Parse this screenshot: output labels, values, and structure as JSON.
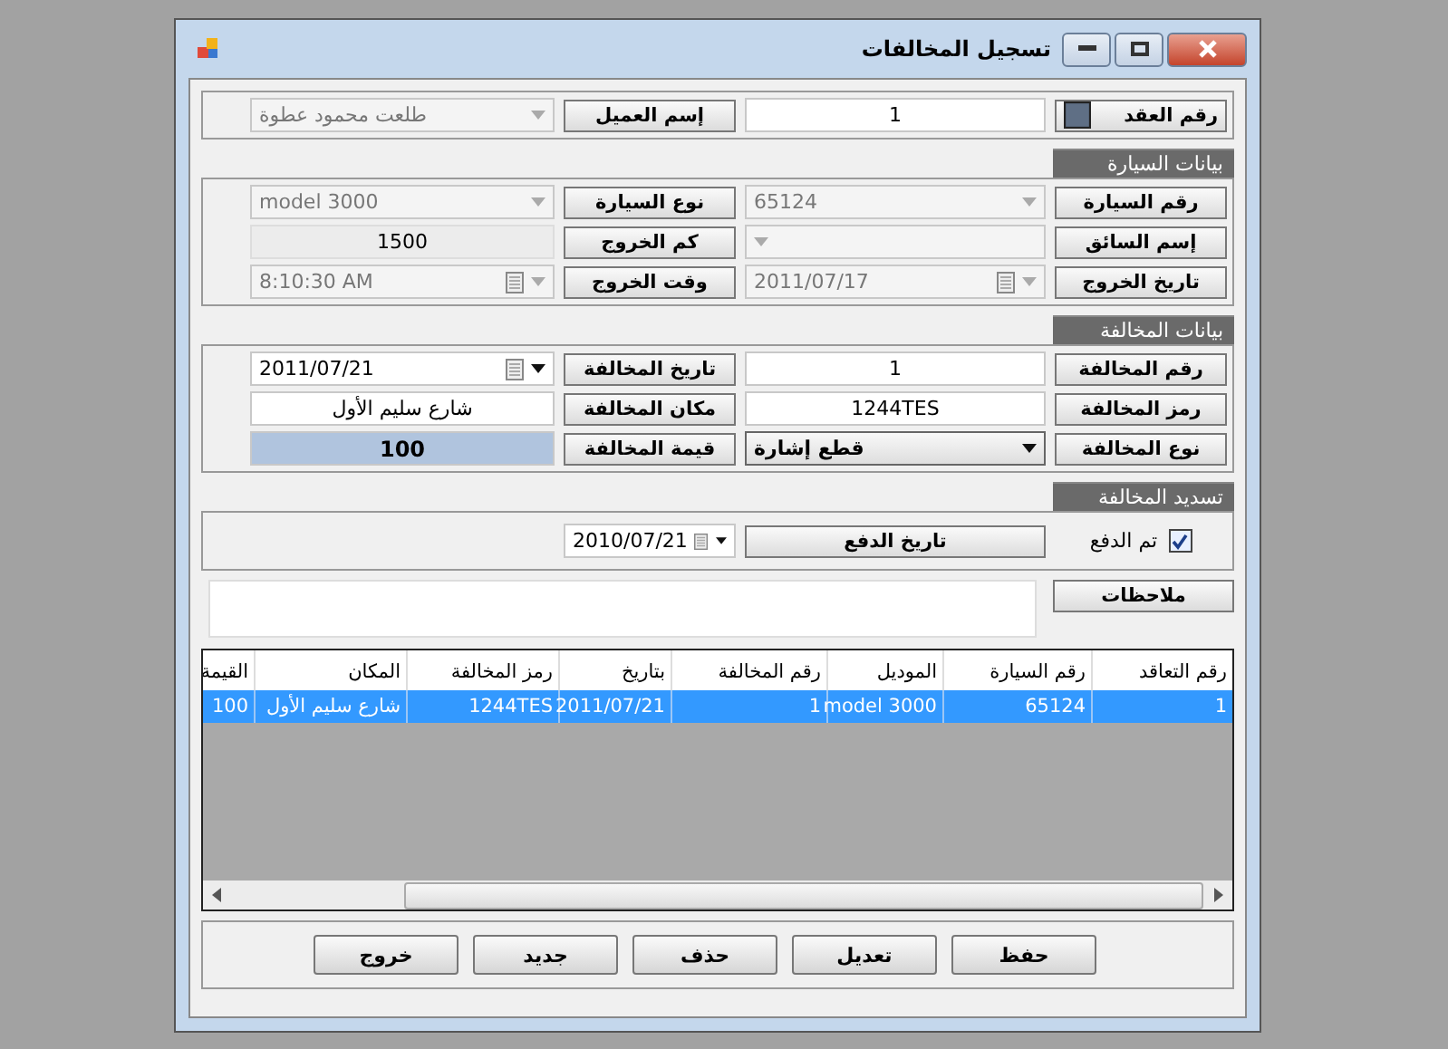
{
  "window": {
    "title": "تسجيل المخالفات"
  },
  "contract": {
    "label": "رقم العقد",
    "value": "1",
    "customer_label": "إسم العميل",
    "customer": "طلعت محمود عطوة",
    "customer_disabled": true
  },
  "sections": [
    {
      "title": "بيانات السيارة",
      "fields": [
        {
          "label": "رقم السيارة",
          "kind": "combo",
          "value": "65124",
          "disabled": true
        },
        {
          "label": "نوع السيارة",
          "kind": "combo",
          "value": "model 3000",
          "disabled": true
        },
        {
          "label": "إسم السائق",
          "kind": "combo",
          "disabled": true
        },
        {
          "label": "كم الخروج",
          "kind": "readonly",
          "value": "1500",
          "disabled": false
        },
        {
          "label": "تاريخ الخروج",
          "kind": "date",
          "value": "2011/07/17",
          "disabled": true
        },
        {
          "label": "وقت الخروج",
          "kind": "date",
          "value": "8:10:30 AM",
          "disabled": true
        }
      ]
    },
    {
      "title": "بيانات المخالفة",
      "fields": [
        {
          "label": "رقم المخالفة",
          "kind": "text",
          "value": "1",
          "disabled": false
        },
        {
          "label": "تاريخ المخالفة",
          "kind": "date",
          "value": "2011/07/21",
          "disabled": false
        },
        {
          "label": "رمز المخالفة",
          "kind": "text",
          "value": "1244TES",
          "disabled": false
        },
        {
          "label": "مكان المخالفة",
          "kind": "text",
          "value": "شارع سليم الأول",
          "disabled": false
        },
        {
          "label": "نوع المخالفة",
          "kind": "dropdown",
          "value": "قطع إشارة",
          "disabled": false
        },
        {
          "label": "قيمة المخالفة",
          "kind": "total",
          "value": "100",
          "disabled": false
        }
      ]
    }
  ],
  "payment": {
    "title": "تسديد المخالفة",
    "paid_label": "تم الدفع",
    "checked": true,
    "date_label": "تاريخ الدفع",
    "date": "2010/07/21"
  },
  "notes": {
    "label": "ملاحظات"
  },
  "table": {
    "columns": [
      "رقم التعاقد",
      "رقم السيارة",
      "الموديل",
      "رقم المخالفة",
      "بتاريخ",
      "رمز المخالفة",
      "المكان",
      "القيمة"
    ],
    "rows": [
      {
        "cells": [
          "1",
          "65124",
          "model 3000",
          "1",
          "2011/07/21",
          "1244TES",
          "شارع سليم الأول",
          "100"
        ],
        "selected": true
      }
    ]
  },
  "buttons": [
    "حفظ",
    "تعديل",
    "حذف",
    "جديد",
    "خروج"
  ]
}
